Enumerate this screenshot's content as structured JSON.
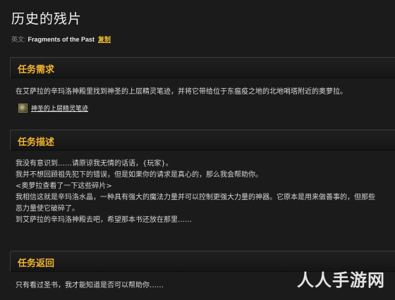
{
  "title": "历史的残片",
  "english": {
    "label": "英文:",
    "name": "Fragments of the Past",
    "copy_label": "复制"
  },
  "requirements": {
    "header": "任务需求",
    "text": "在艾萨拉的辛玛洛神殿里找到神圣的上层精灵笔迹，并将它带给位于东瘟疫之地的北地哨塔附近的奥萝拉。",
    "reward_item": "神圣的上层精灵笔迹"
  },
  "description": {
    "header": "任务描述",
    "lines": [
      "我没有意识到……请原谅我无情的话语，{玩家}。",
      "我并不想回顾祖先犯下的错误，但是如果你的请求是真心的，那么我会帮助你。",
      "<奥萝拉查看了一下这些碎片>",
      "我相信这就是辛玛洛水晶，一种具有强大的魔法力量并可以控制更强大力量的神器。它原本是用来做善事的，但那些",
      "恶力量使它破碎了。",
      "到艾萨拉的辛玛洛神殿去吧，希望那本书还放在那里……"
    ]
  },
  "completion": {
    "header": "任务返回",
    "text": "只有看过圣书，我才能知道是否可以帮助你……"
  },
  "watermark": "人人手游网"
}
